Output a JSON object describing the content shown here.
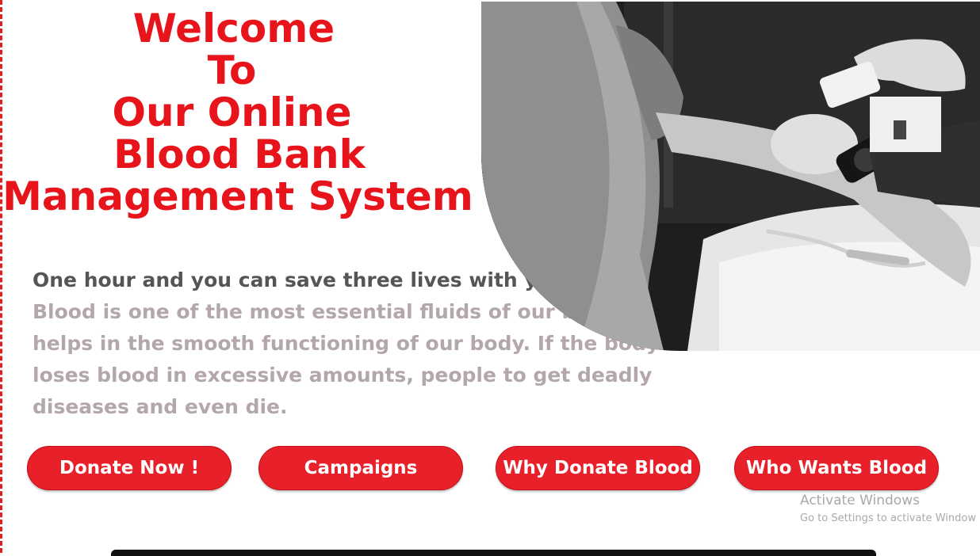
{
  "hero": {
    "title_lines": [
      "Welcome",
      "To",
      "Our Online",
      "Blood Bank",
      "Management System"
    ],
    "intro_bold": "One hour and you can save three lives with your blood.",
    "intro_rest": " Blood is one of the most essential fluids of our body that helps in the smooth functioning of our body. If the body loses blood in excessive amounts, people to get deadly diseases and even die.",
    "image_icon": "blood-donation-photo"
  },
  "actions": {
    "donate": "Donate Now !",
    "campaigns": "Campaigns",
    "why": "Why Donate Blood",
    "who": "Who Wants Blood"
  },
  "watermark": {
    "title": "Activate Windows",
    "subtitle": "Go to Settings to activate Window"
  },
  "colors": {
    "accent": "#e8141b",
    "text_dark": "#555555",
    "text_light": "#b3a7aa"
  }
}
